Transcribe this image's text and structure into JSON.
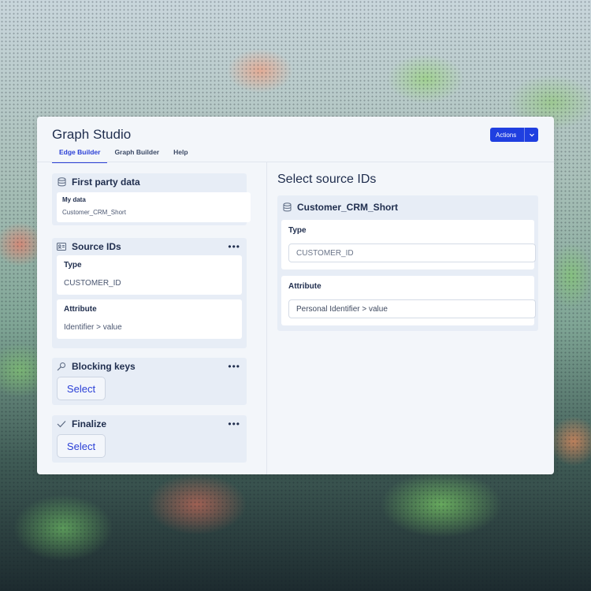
{
  "app": {
    "title": "Graph Studio",
    "actions_label": "Actions"
  },
  "tabs": [
    {
      "label": "Edge Builder",
      "active": true
    },
    {
      "label": "Graph Builder",
      "active": false
    },
    {
      "label": "Help",
      "active": false
    }
  ],
  "left": {
    "first_party": {
      "title": "First party data",
      "field_label": "My data",
      "field_value": "Customer_CRM_Short"
    },
    "source_ids": {
      "title": "Source IDs",
      "type_label": "Type",
      "type_value": "CUSTOMER_ID",
      "attr_label": "Attribute",
      "attr_value": "Identifier > value"
    },
    "blocking_keys": {
      "title": "Blocking keys",
      "button": "Select"
    },
    "finalize": {
      "title": "Finalize",
      "button": "Select"
    },
    "more_glyph": "•••"
  },
  "right": {
    "title": "Select source IDs",
    "dataset": "Customer_CRM_Short",
    "type_label": "Type",
    "type_value": "CUSTOMER_ID",
    "attr_label": "Attribute",
    "attr_value": "Personal Identifier > value"
  },
  "icons": {
    "database": "database-icon",
    "id_card": "id-card-icon",
    "key": "key-icon",
    "check": "check-icon",
    "chevron": "chevron-down-icon"
  },
  "colors": {
    "accent": "#1f3fe0",
    "text": "#1f2d4d"
  }
}
